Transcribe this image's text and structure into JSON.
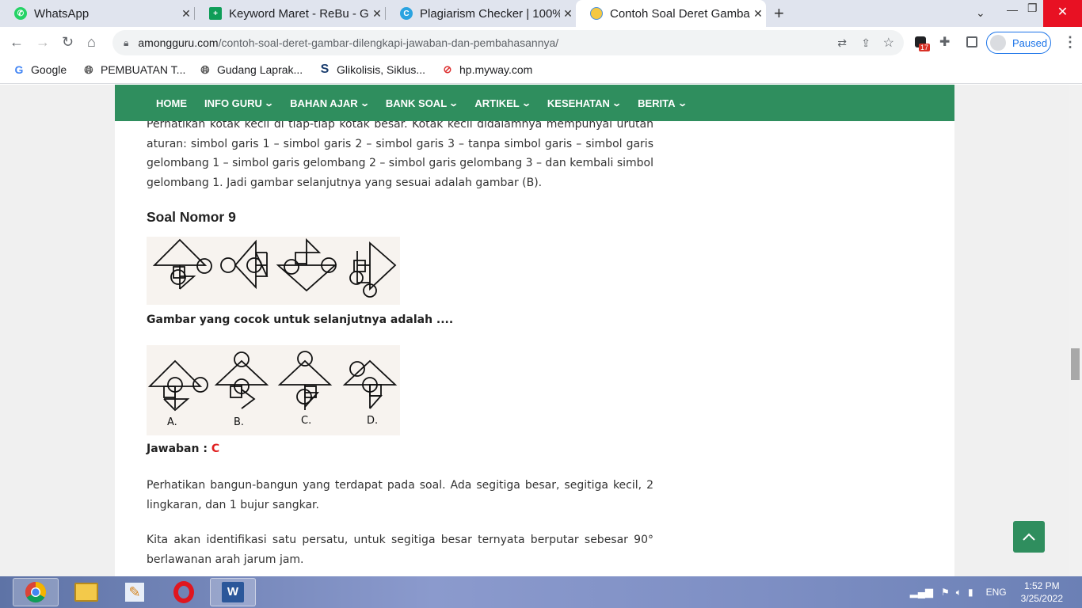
{
  "tabs": [
    {
      "title": "WhatsApp",
      "icon": "whatsapp-icon"
    },
    {
      "title": "Keyword Maret - ReBu - Go",
      "icon": "sheets-icon"
    },
    {
      "title": "Plagiarism Checker | 100%",
      "icon": "plagiarism-c-icon"
    },
    {
      "title": "Contoh Soal Deret Gamba",
      "icon": "site-favicon"
    }
  ],
  "url": {
    "domain": "amongguru.com",
    "path": "/contoh-soal-deret-gambar-dilengkapi-jawaban-dan-pembahasannya/"
  },
  "extensions_badge": "17",
  "profile_label": "Paused",
  "bookmarks": [
    {
      "label": "Google",
      "icon": "google-icon"
    },
    {
      "label": "PEMBUATAN T...",
      "icon": "globe-icon"
    },
    {
      "label": "Gudang Laprak...",
      "icon": "globe-icon"
    },
    {
      "label": "Glikolisis, Siklus...",
      "icon": "bookmark-s-icon"
    },
    {
      "label": "hp.myway.com",
      "icon": "myway-icon"
    }
  ],
  "nav": [
    "HOME",
    "INFO GURU",
    "BAHAN AJAR",
    "BANK SOAL",
    "ARTIKEL",
    "KESEHATAN",
    "BERITA"
  ],
  "article": {
    "intro": "Perhatikan kotak kecil di tiap-tiap kotak besar. Kotak kecil didalamnya mempunyai urutan aturan: simbol garis 1 – simbol garis 2 – simbol garis 3 – tanpa simbol garis – simbol garis gelombang 1 – simbol garis gelombang 2 – simbol garis gelombang 3 – dan kembali simbol gelombang 1. Jadi gambar selanjutnya yang sesuai adalah gambar (B).",
    "heading": "Soal Nomor 9",
    "question": "Gambar yang cocok untuk selanjutnya adalah ....",
    "options": [
      "A.",
      "B.",
      "C.",
      "D."
    ],
    "answer_label": "Jawaban : ",
    "answer_value": "C",
    "explain1": "Perhatikan bangun-bangun yang terdapat pada soal. Ada segitiga besar, segitiga kecil, 2 lingkaran, dan 1 bujur sangkar.",
    "explain2": "Kita akan identifikasi satu persatu, untuk segitiga besar ternyata berputar sebesar 90° berlawanan arah jarum jam."
  },
  "taskbar": {
    "apps": [
      "chrome-icon",
      "file-explorer-icon",
      "pen-app-icon",
      "opera-icon",
      "word-icon"
    ],
    "language": "ENG",
    "time": "1:52 PM",
    "date": "3/25/2022"
  },
  "colors": {
    "nav_green": "#2f8e5e",
    "answer_red": "#e02020",
    "tab_bar": "#e0e4ee"
  }
}
